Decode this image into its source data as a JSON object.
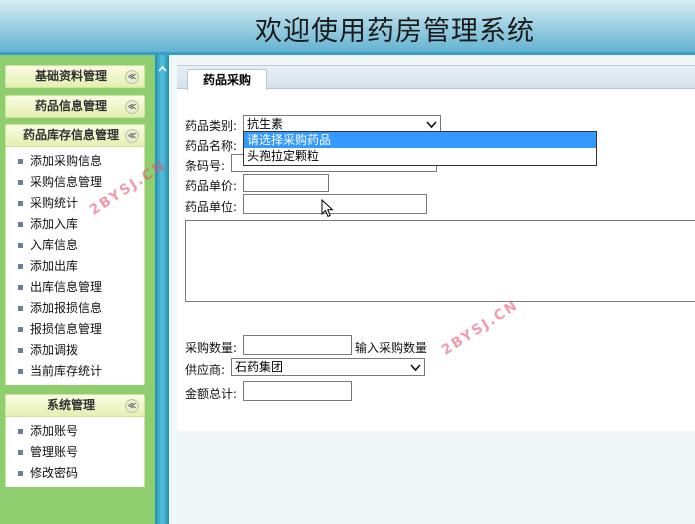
{
  "header": {
    "title": "欢迎使用药房管理系统"
  },
  "sidebar": {
    "groups": [
      {
        "title": "基础资料管理",
        "items": []
      },
      {
        "title": "药品信息管理",
        "items": []
      },
      {
        "title": "药品库存信息管理",
        "items": [
          "添加采购信息",
          "采购信息管理",
          "采购统计",
          "添加入库",
          "入库信息",
          "添加出库",
          "出库信息管理",
          "添加报损信息",
          "报损信息管理",
          "添加调拨",
          "当前库存统计"
        ]
      },
      {
        "title": "系统管理",
        "items": [
          "添加账号",
          "管理账号",
          "修改密码"
        ]
      }
    ],
    "toggle_glyph": "≪"
  },
  "tab": {
    "label": "药品采购"
  },
  "form": {
    "category_label": "药品类别:",
    "category_value": "抗生素",
    "name_label": "药品名称:",
    "barcode_label": "条码号:",
    "price_label": "药品单价:",
    "unit_label": "药品单位:",
    "qty_label": "采购数量:",
    "qty_hint": "输入采购数量",
    "supplier_label": "供应商:",
    "supplier_value": "石药集团",
    "total_label": "金额总计:"
  },
  "dropdown": {
    "options": [
      "请选择采购药品",
      "头孢拉定颗粒"
    ],
    "selected_index": 0
  },
  "watermarks": [
    "2BYSJ.CN",
    "2BYSJ.CN"
  ],
  "icons": {
    "collapse": "chevron-up-icon",
    "splitter": "collapse-left-icon",
    "cursor": "mouse-cursor-icon"
  }
}
